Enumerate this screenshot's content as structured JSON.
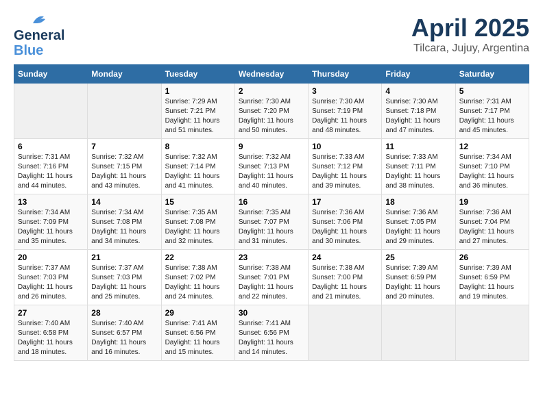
{
  "header": {
    "logo_general": "General",
    "logo_blue": "Blue",
    "month_year": "April 2025",
    "location": "Tilcara, Jujuy, Argentina"
  },
  "weekdays": [
    "Sunday",
    "Monday",
    "Tuesday",
    "Wednesday",
    "Thursday",
    "Friday",
    "Saturday"
  ],
  "weeks": [
    [
      {
        "day": "",
        "empty": true
      },
      {
        "day": "",
        "empty": true
      },
      {
        "day": "1",
        "sunrise": "Sunrise: 7:29 AM",
        "sunset": "Sunset: 7:21 PM",
        "daylight": "Daylight: 11 hours and 51 minutes."
      },
      {
        "day": "2",
        "sunrise": "Sunrise: 7:30 AM",
        "sunset": "Sunset: 7:20 PM",
        "daylight": "Daylight: 11 hours and 50 minutes."
      },
      {
        "day": "3",
        "sunrise": "Sunrise: 7:30 AM",
        "sunset": "Sunset: 7:19 PM",
        "daylight": "Daylight: 11 hours and 48 minutes."
      },
      {
        "day": "4",
        "sunrise": "Sunrise: 7:30 AM",
        "sunset": "Sunset: 7:18 PM",
        "daylight": "Daylight: 11 hours and 47 minutes."
      },
      {
        "day": "5",
        "sunrise": "Sunrise: 7:31 AM",
        "sunset": "Sunset: 7:17 PM",
        "daylight": "Daylight: 11 hours and 45 minutes."
      }
    ],
    [
      {
        "day": "6",
        "sunrise": "Sunrise: 7:31 AM",
        "sunset": "Sunset: 7:16 PM",
        "daylight": "Daylight: 11 hours and 44 minutes."
      },
      {
        "day": "7",
        "sunrise": "Sunrise: 7:32 AM",
        "sunset": "Sunset: 7:15 PM",
        "daylight": "Daylight: 11 hours and 43 minutes."
      },
      {
        "day": "8",
        "sunrise": "Sunrise: 7:32 AM",
        "sunset": "Sunset: 7:14 PM",
        "daylight": "Daylight: 11 hours and 41 minutes."
      },
      {
        "day": "9",
        "sunrise": "Sunrise: 7:32 AM",
        "sunset": "Sunset: 7:13 PM",
        "daylight": "Daylight: 11 hours and 40 minutes."
      },
      {
        "day": "10",
        "sunrise": "Sunrise: 7:33 AM",
        "sunset": "Sunset: 7:12 PM",
        "daylight": "Daylight: 11 hours and 39 minutes."
      },
      {
        "day": "11",
        "sunrise": "Sunrise: 7:33 AM",
        "sunset": "Sunset: 7:11 PM",
        "daylight": "Daylight: 11 hours and 38 minutes."
      },
      {
        "day": "12",
        "sunrise": "Sunrise: 7:34 AM",
        "sunset": "Sunset: 7:10 PM",
        "daylight": "Daylight: 11 hours and 36 minutes."
      }
    ],
    [
      {
        "day": "13",
        "sunrise": "Sunrise: 7:34 AM",
        "sunset": "Sunset: 7:09 PM",
        "daylight": "Daylight: 11 hours and 35 minutes."
      },
      {
        "day": "14",
        "sunrise": "Sunrise: 7:34 AM",
        "sunset": "Sunset: 7:08 PM",
        "daylight": "Daylight: 11 hours and 34 minutes."
      },
      {
        "day": "15",
        "sunrise": "Sunrise: 7:35 AM",
        "sunset": "Sunset: 7:08 PM",
        "daylight": "Daylight: 11 hours and 32 minutes."
      },
      {
        "day": "16",
        "sunrise": "Sunrise: 7:35 AM",
        "sunset": "Sunset: 7:07 PM",
        "daylight": "Daylight: 11 hours and 31 minutes."
      },
      {
        "day": "17",
        "sunrise": "Sunrise: 7:36 AM",
        "sunset": "Sunset: 7:06 PM",
        "daylight": "Daylight: 11 hours and 30 minutes."
      },
      {
        "day": "18",
        "sunrise": "Sunrise: 7:36 AM",
        "sunset": "Sunset: 7:05 PM",
        "daylight": "Daylight: 11 hours and 29 minutes."
      },
      {
        "day": "19",
        "sunrise": "Sunrise: 7:36 AM",
        "sunset": "Sunset: 7:04 PM",
        "daylight": "Daylight: 11 hours and 27 minutes."
      }
    ],
    [
      {
        "day": "20",
        "sunrise": "Sunrise: 7:37 AM",
        "sunset": "Sunset: 7:03 PM",
        "daylight": "Daylight: 11 hours and 26 minutes."
      },
      {
        "day": "21",
        "sunrise": "Sunrise: 7:37 AM",
        "sunset": "Sunset: 7:03 PM",
        "daylight": "Daylight: 11 hours and 25 minutes."
      },
      {
        "day": "22",
        "sunrise": "Sunrise: 7:38 AM",
        "sunset": "Sunset: 7:02 PM",
        "daylight": "Daylight: 11 hours and 24 minutes."
      },
      {
        "day": "23",
        "sunrise": "Sunrise: 7:38 AM",
        "sunset": "Sunset: 7:01 PM",
        "daylight": "Daylight: 11 hours and 22 minutes."
      },
      {
        "day": "24",
        "sunrise": "Sunrise: 7:38 AM",
        "sunset": "Sunset: 7:00 PM",
        "daylight": "Daylight: 11 hours and 21 minutes."
      },
      {
        "day": "25",
        "sunrise": "Sunrise: 7:39 AM",
        "sunset": "Sunset: 6:59 PM",
        "daylight": "Daylight: 11 hours and 20 minutes."
      },
      {
        "day": "26",
        "sunrise": "Sunrise: 7:39 AM",
        "sunset": "Sunset: 6:59 PM",
        "daylight": "Daylight: 11 hours and 19 minutes."
      }
    ],
    [
      {
        "day": "27",
        "sunrise": "Sunrise: 7:40 AM",
        "sunset": "Sunset: 6:58 PM",
        "daylight": "Daylight: 11 hours and 18 minutes."
      },
      {
        "day": "28",
        "sunrise": "Sunrise: 7:40 AM",
        "sunset": "Sunset: 6:57 PM",
        "daylight": "Daylight: 11 hours and 16 minutes."
      },
      {
        "day": "29",
        "sunrise": "Sunrise: 7:41 AM",
        "sunset": "Sunset: 6:56 PM",
        "daylight": "Daylight: 11 hours and 15 minutes."
      },
      {
        "day": "30",
        "sunrise": "Sunrise: 7:41 AM",
        "sunset": "Sunset: 6:56 PM",
        "daylight": "Daylight: 11 hours and 14 minutes."
      },
      {
        "day": "",
        "empty": true
      },
      {
        "day": "",
        "empty": true
      },
      {
        "day": "",
        "empty": true
      }
    ]
  ]
}
